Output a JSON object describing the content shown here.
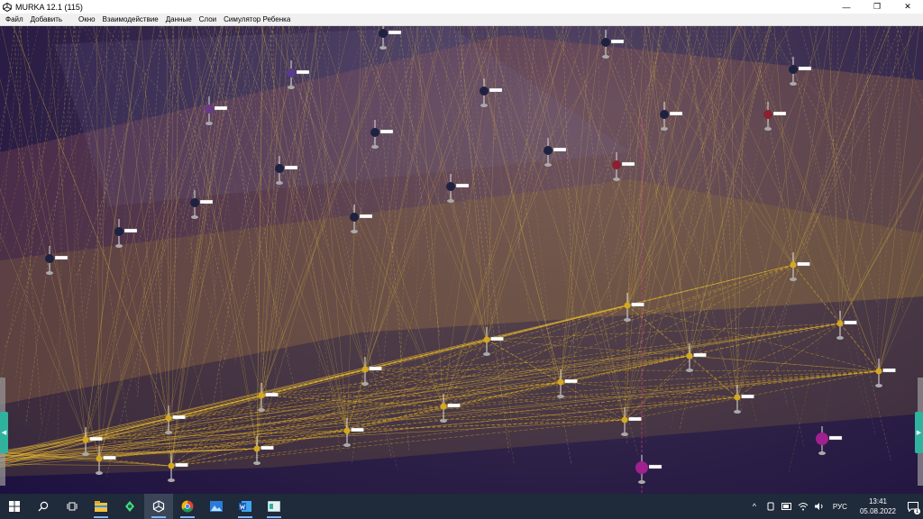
{
  "window": {
    "title": "MURKA 12.1 (115)",
    "controls": {
      "minimize": "—",
      "maximize": "❐",
      "close": "✕"
    }
  },
  "menu": [
    "Файл",
    "Добавить",
    "Окно",
    "Взаимодействие",
    "Данные",
    "Слои",
    "Симулятор Ребенка"
  ],
  "viewport": {
    "left_handle": "◀",
    "right_handle": "▶"
  },
  "taskbar": {
    "apps": [
      "start-icon",
      "search-icon",
      "task-view-icon",
      "file-explorer-icon",
      "android-studio-icon",
      "unity-icon",
      "chrome-icon",
      "photos-icon",
      "word-icon",
      "app-window-icon"
    ]
  },
  "tray": {
    "chevron": "^",
    "language": "РУС",
    "time": "13:41",
    "date": "05.08.2022",
    "notification_count": "1"
  },
  "colors": {
    "taskbar": "#1f2a3a",
    "edge_yellow": "#e0b020",
    "handle_teal": "#2fb39f"
  }
}
